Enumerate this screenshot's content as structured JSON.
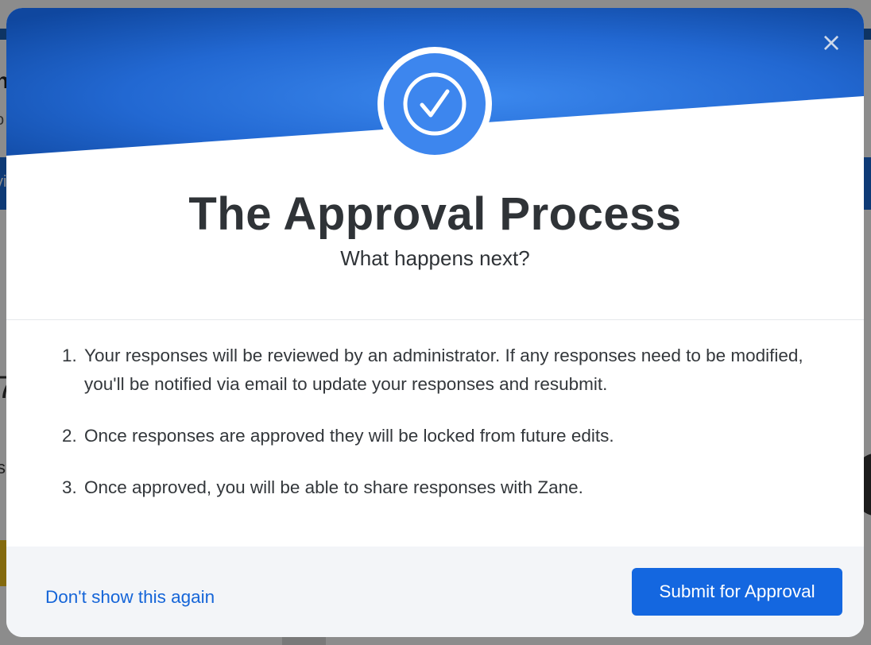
{
  "background": {
    "title_fragment": "n",
    "subtitle_fragment": "o",
    "band_text_fragment": "vi",
    "glyph_a": "7",
    "glyph_b": "s"
  },
  "modal": {
    "close_label": "×",
    "title": "The Approval Process",
    "subtitle": "What happens next?",
    "steps": [
      {
        "number": "1.",
        "text": "Your responses will be reviewed by an administrator. If any responses need to be modified, you'll be notified via email to update your responses and resubmit."
      },
      {
        "number": "2.",
        "text": "Once responses are approved they will be locked from future edits."
      },
      {
        "number": "3.",
        "text": "Once approved, you will be able to share responses with Zane."
      }
    ],
    "footer": {
      "dont_show_label": "Don't show this again",
      "submit_label": "Submit for Approval"
    }
  },
  "colors": {
    "hero_gradient_start": "#1049a6",
    "hero_gradient_mid": "#3b88ee",
    "hero_gradient_end": "#1452b4",
    "primary_button": "#1467e0",
    "link": "#1565d8",
    "badge": "#3d86ee"
  },
  "icons": {
    "badge": "check-circle-icon",
    "close": "close-icon"
  }
}
